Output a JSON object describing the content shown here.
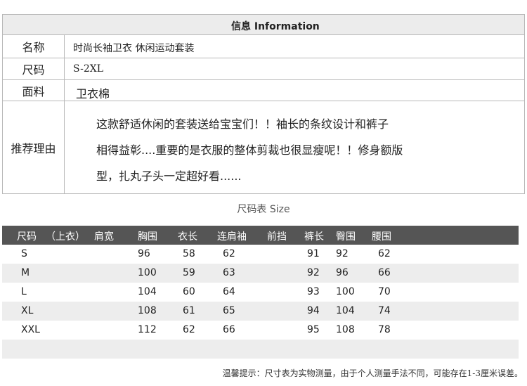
{
  "info": {
    "header_title": "信息 Information",
    "rows": [
      {
        "label": "名称",
        "value": "时尚长袖卫衣 休闲运动套装"
      },
      {
        "label": "尺码",
        "value": "S-2XL"
      },
      {
        "label": "面料",
        "value": "卫衣棉"
      },
      {
        "label": "推荐理由",
        "lines": [
          "这款舒适休闲的套装送给宝宝们！！袖长的条纹设计和裤子",
          "相得益彰....重要的是衣服的整体剪裁也很显瘦呢！！修身额版",
          "型，扎丸子头一定超好看......"
        ]
      }
    ]
  },
  "size_chart": {
    "caption": "尺码表 Size",
    "headers": [
      "尺码",
      "（上衣）",
      "肩宽",
      "胸围",
      "衣长",
      "连肩袖",
      "前挡",
      "裤长",
      "臀围",
      "腰围"
    ],
    "rows": [
      {
        "size": "S",
        "bust": "96",
        "length": "58",
        "sleeve": "62",
        "pants": "91",
        "hip": "92",
        "waist": "62"
      },
      {
        "size": "M",
        "bust": "100",
        "length": "59",
        "sleeve": "63",
        "pants": "92",
        "hip": "96",
        "waist": "66"
      },
      {
        "size": "L",
        "bust": "104",
        "length": "60",
        "sleeve": "64",
        "pants": "93",
        "hip": "100",
        "waist": "70"
      },
      {
        "size": "XL",
        "bust": "108",
        "length": "61",
        "sleeve": "65",
        "pants": "94",
        "hip": "104",
        "waist": "74"
      },
      {
        "size": "XXL",
        "bust": "112",
        "length": "62",
        "sleeve": "66",
        "pants": "95",
        "hip": "108",
        "waist": "78"
      }
    ]
  },
  "note": "温馨提示：尺寸表为实物测量，由于个人测量手法不同，可能存在1-3厘米误差。"
}
